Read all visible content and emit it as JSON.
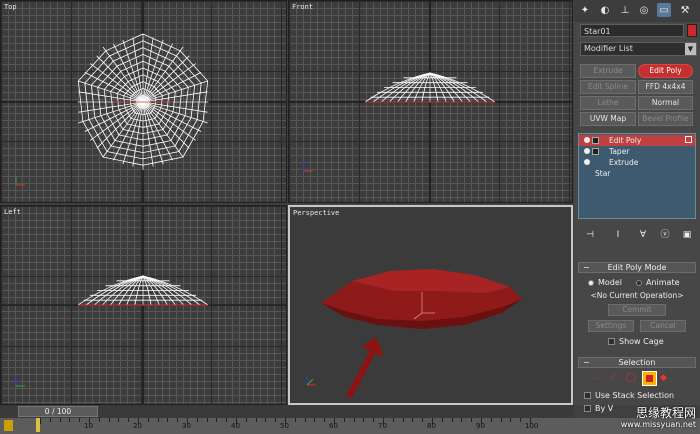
{
  "viewports": {
    "top": {
      "label": "Top"
    },
    "front": {
      "label": "Front"
    },
    "left": {
      "label": "Left"
    },
    "perspective": {
      "label": "Perspective"
    }
  },
  "command_panel": {
    "tabs": [
      "create-icon",
      "modify-icon",
      "hierarchy-icon",
      "motion-icon",
      "display-icon",
      "utilities-icon"
    ],
    "object_name": "Star01",
    "object_color": "#c62a2a",
    "modifier_list": "Modifier List",
    "modifier_buttons": {
      "extrude": "Extrude",
      "edit_poly": "Edit Poly",
      "edit_spline": "Edit Spline",
      "ffd": "FFD 4x4x4",
      "lathe": "Lathe",
      "normal": "Normal",
      "uvw_map": "UVW Map",
      "bevel_profile": "Bevel Profile"
    },
    "stack": [
      "Edit Poly",
      "Taper",
      "Extrude",
      "Star"
    ],
    "stack_icons": [
      "pin-stack-icon",
      "show-end-result-icon",
      "make-unique-icon",
      "remove-modifier-icon",
      "configure-sets-icon"
    ],
    "edit_poly_mode": {
      "title": "Edit Poly Mode",
      "model": "Model",
      "animate": "Animate",
      "status": "<No Current Operation>",
      "commit": "Commit",
      "settings": "Settings",
      "cancel": "Cancel",
      "show_cage": "Show Cage"
    },
    "selection": {
      "title": "Selection",
      "use_stack": "Use Stack Selection",
      "by_vertex": "By V"
    }
  },
  "timeline": {
    "slider": "0 / 100",
    "ticks": [
      "10",
      "20",
      "30",
      "40",
      "50",
      "60",
      "70",
      "80",
      "90",
      "100"
    ]
  },
  "watermark": {
    "cn": "思缘教程网",
    "url": "www.missyuan.net"
  },
  "colors": {
    "accent": "#c23030",
    "mesh": "#ffffff",
    "object": "#8e1a1a"
  }
}
